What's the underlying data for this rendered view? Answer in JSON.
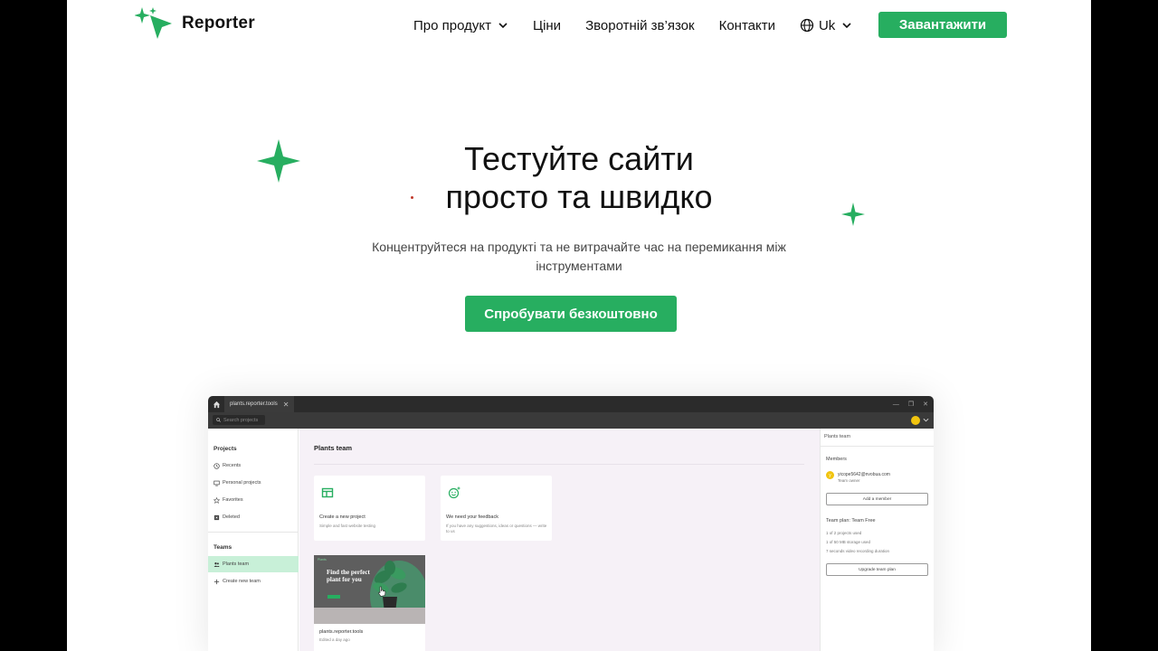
{
  "header": {
    "brand": "Reporter",
    "nav": [
      {
        "label": "Про продукт"
      },
      {
        "label": "Ціни"
      },
      {
        "label": "Зворотній зв’язок"
      },
      {
        "label": "Контакти"
      }
    ],
    "language": "Uk",
    "download_label": "Завантажити"
  },
  "hero": {
    "title_line1": "Тестуйте сайти",
    "title_line2": "просто та швидко",
    "subtitle": "Концентруйтеся на продукті та не витрачайте час на перемикання між інструментами",
    "cta_label": "Спробувати безкоштовно"
  },
  "app": {
    "tab_title": "plants.reporter.tools",
    "search_placeholder": "Search projects",
    "sidebar": {
      "projects_heading": "Projects",
      "items": [
        "Recents",
        "Personal projects",
        "Favorites",
        "Deleted"
      ],
      "teams_heading": "Teams",
      "team_items": [
        "Plants team",
        "Create new team"
      ]
    },
    "main": {
      "title": "Plants team",
      "cards": [
        {
          "title": "Create a new project",
          "subtitle": "Simple and fast website testing"
        },
        {
          "title": "We need your feedback",
          "subtitle": "If you have any suggestions, ideas or questions — write to us"
        }
      ],
      "project": {
        "name": "plants.reporter.tools",
        "edited": "Edited a day ago",
        "thumb_brand": "Plants",
        "thumb_heading": "Find the perfect plant for you"
      }
    },
    "right_panel": {
      "title": "Plants team",
      "members_heading": "Members",
      "member_initial": "y",
      "member_email": "yicope5642@nvobua.com",
      "member_role": "Team owner",
      "add_member_label": "Add a member",
      "plan_heading": "Team plan: Team Free",
      "plan_lines": [
        "1 of 2 projects used",
        "1 of 50 MB storage used",
        "7 seconds video recording duration"
      ],
      "upgrade_label": "Upgrade team plan"
    }
  },
  "colors": {
    "accent": "#27ae60",
    "active_bg": "#c8f0d8"
  }
}
